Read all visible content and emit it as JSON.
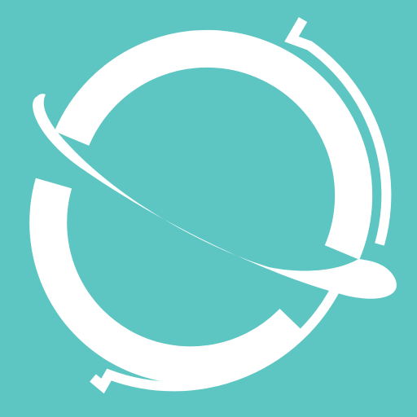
{
  "logo": {
    "icon": "globe-orbit-icon",
    "colors": {
      "background": "#5dc6c2",
      "foreground": "#ffffff"
    }
  }
}
